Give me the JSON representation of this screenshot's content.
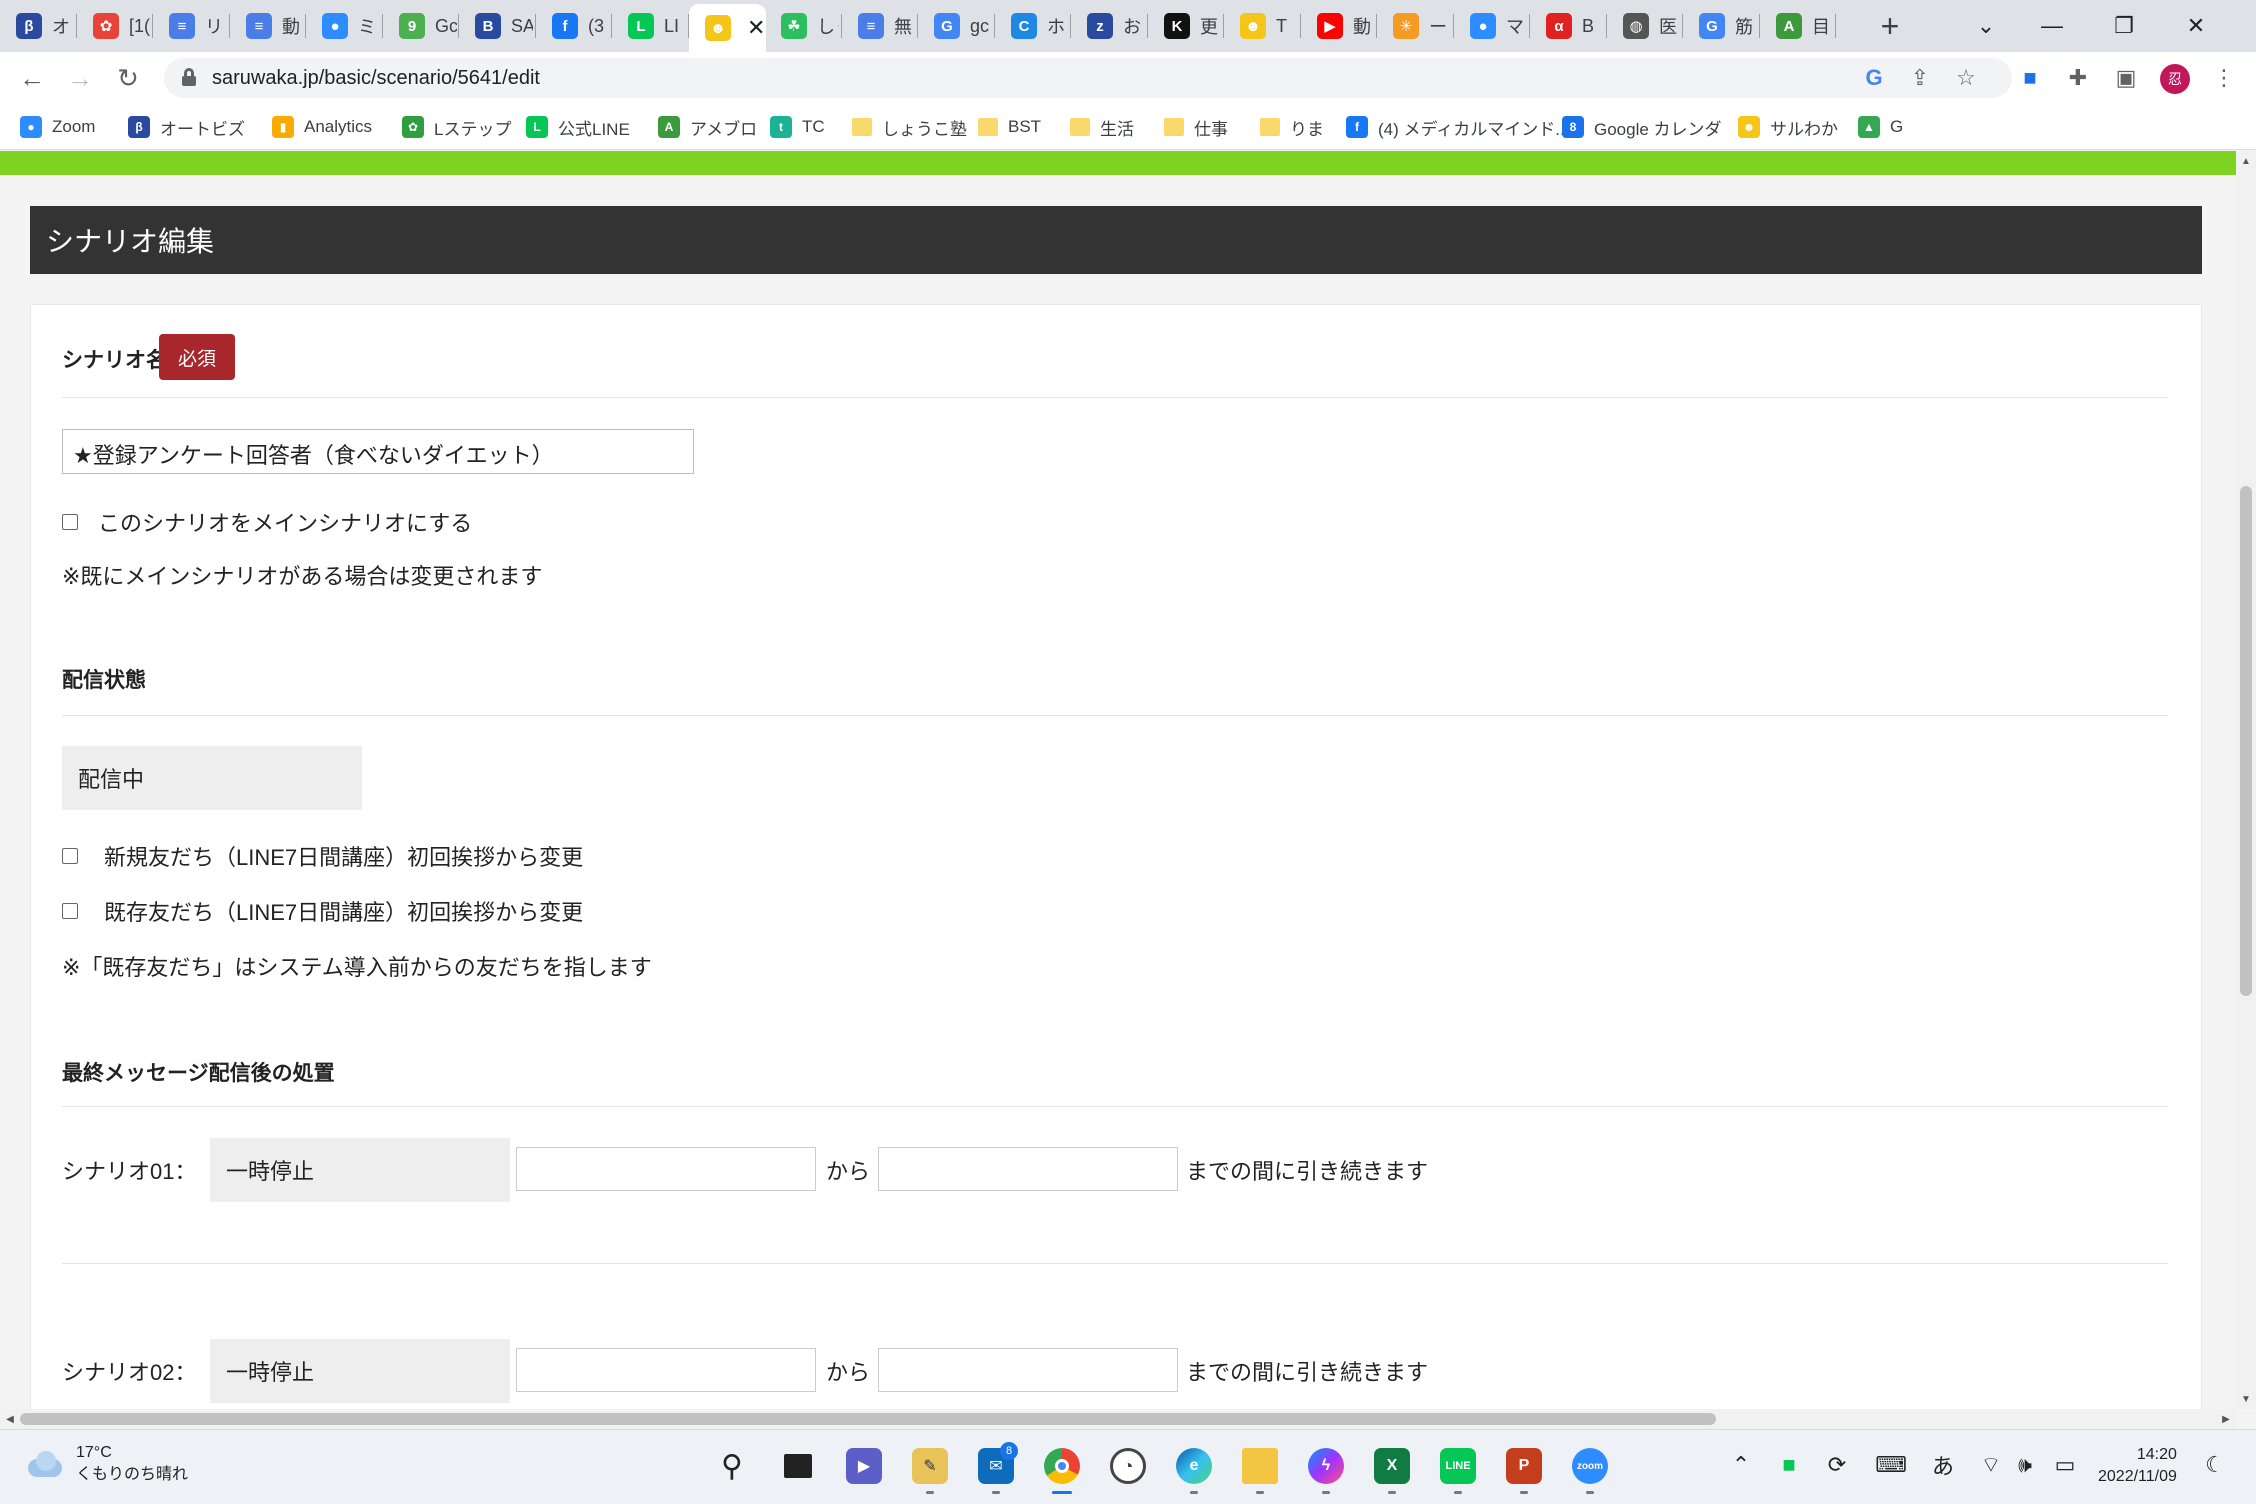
{
  "browser": {
    "tabs": [
      {
        "icon": "β",
        "color": "#2a4aa0",
        "title": "オ"
      },
      {
        "icon": "✿",
        "color": "#e8423a",
        "title": "[1("
      },
      {
        "icon": "≡",
        "color": "#4a7de8",
        "title": "リ"
      },
      {
        "icon": "≡",
        "color": "#4a7de8",
        "title": "動"
      },
      {
        "icon": "●",
        "color": "#2d8cff",
        "title": "ミ"
      },
      {
        "icon": "9",
        "color": "#4caf50",
        "title": "Gc"
      },
      {
        "icon": "B",
        "color": "#2a4aa0",
        "title": "SA"
      },
      {
        "icon": "f",
        "color": "#1877f2",
        "title": "(3"
      },
      {
        "icon": "L",
        "color": "#06c755",
        "title": "LI"
      },
      {
        "icon": "☻",
        "color": "#f5c518",
        "title": "",
        "active": true
      },
      {
        "icon": "☘",
        "color": "#2dbe60",
        "title": "しく"
      },
      {
        "icon": "≡",
        "color": "#4a7de8",
        "title": "無"
      },
      {
        "icon": "G",
        "color": "#4285f4",
        "title": "gc"
      },
      {
        "icon": "C",
        "color": "#1e88e5",
        "title": "ホ"
      },
      {
        "icon": "z",
        "color": "#2a4aa0",
        "title": "お"
      },
      {
        "icon": "K",
        "color": "#111111",
        "title": "更"
      },
      {
        "icon": "☻",
        "color": "#f5c518",
        "title": "T"
      },
      {
        "icon": "▶",
        "color": "#ff0000",
        "title": "動"
      },
      {
        "icon": "✳",
        "color": "#f59a23",
        "title": "ー"
      },
      {
        "icon": "●",
        "color": "#2d8cff",
        "title": "マ"
      },
      {
        "icon": "α",
        "color": "#e1211f",
        "title": "B"
      },
      {
        "icon": "◍",
        "color": "#555555",
        "title": "医"
      },
      {
        "icon": "G",
        "color": "#4285f4",
        "title": "筋"
      },
      {
        "icon": "A",
        "color": "#3c9a3c",
        "title": "目"
      }
    ],
    "url": "saruwaka.jp/basic/scenario/5641/edit",
    "profile_initial": "忍"
  },
  "bookmarks": [
    {
      "label": "Zoom",
      "icon": "●",
      "color": "#2d8cff"
    },
    {
      "label": "オートビズ",
      "icon": "β",
      "color": "#2a4aa0"
    },
    {
      "label": "Analytics",
      "icon": "▮",
      "color": "#f9ab00"
    },
    {
      "label": "Lステップ",
      "icon": "✿",
      "color": "#2e9e3e"
    },
    {
      "label": "公式LINE",
      "icon": "L",
      "color": "#06c755"
    },
    {
      "label": "アメブロ",
      "icon": "A",
      "color": "#3c9a3c"
    },
    {
      "label": "TC",
      "icon": "t",
      "color": "#1bb394"
    },
    {
      "label": "しょうこ塾",
      "icon": "folder",
      "color": "#f9d96b"
    },
    {
      "label": "BST",
      "icon": "folder",
      "color": "#f9d96b"
    },
    {
      "label": "生活",
      "icon": "folder",
      "color": "#f9d96b"
    },
    {
      "label": "仕事",
      "icon": "folder",
      "color": "#f9d96b"
    },
    {
      "label": "りま",
      "icon": "folder",
      "color": "#f9d96b"
    },
    {
      "label": "(4) メディカルマインド...",
      "icon": "f",
      "color": "#1877f2"
    },
    {
      "label": "Google カレンダ",
      "icon": "8",
      "color": "#1a73e8"
    },
    {
      "label": "サルわか",
      "icon": "☻",
      "color": "#f5c518"
    },
    {
      "label": "G",
      "icon": "▲",
      "color": "#34a853"
    }
  ],
  "page": {
    "header": "シナリオ編集",
    "scenario_name": {
      "label": "シナリオ名",
      "required": "必須",
      "value": "★登録アンケート回答者（食べないダイエット）",
      "main_checkbox_label": "このシナリオをメインシナリオにする",
      "note": "※既にメインシナリオがある場合は変更されます"
    },
    "delivery": {
      "label": "配信状態",
      "status": "配信中",
      "checkbox_new": "新規友だち（LINE7日間講座）初回挨拶から変更",
      "checkbox_existing": "既存友だち（LINE7日間講座）初回挨拶から変更",
      "note": "※「既存友だち」はシステム導入前からの友だちを指します"
    },
    "final": {
      "label": "最終メッセージ配信後の処置",
      "rows": [
        {
          "label": "シナリオ01：",
          "action": "一時停止",
          "from": "から",
          "suffix": "までの間に引き続きます"
        },
        {
          "label": "シナリオ02：",
          "action": "一時停止",
          "from": "から",
          "suffix": "までの間に引き続きます"
        }
      ]
    }
  },
  "taskbar": {
    "weather_temp": "17°C",
    "weather_desc": "くもりのち晴れ",
    "mail_badge": "8",
    "time": "14:20",
    "date": "2022/11/09",
    "ime": "あ"
  }
}
